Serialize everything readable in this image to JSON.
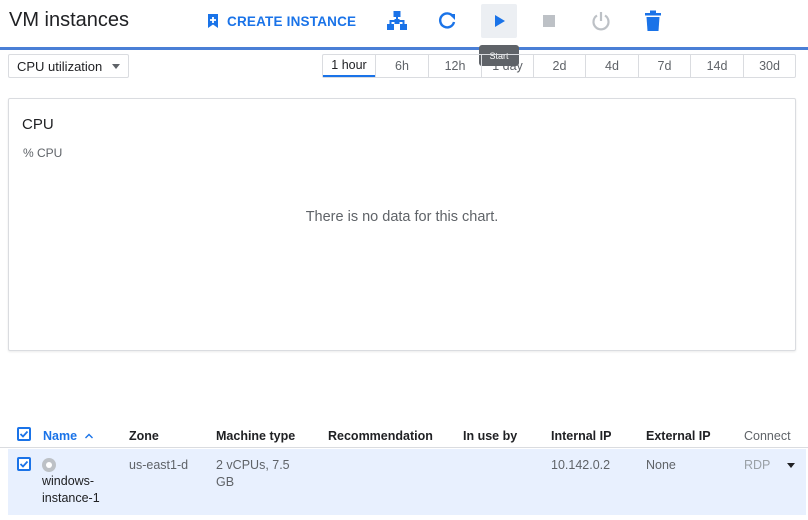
{
  "header": {
    "title": "VM instances",
    "create_label": "CREATE INSTANCE",
    "tooltip": "Start"
  },
  "toolbar_icons": [
    "import-vm-icon",
    "refresh-icon",
    "start-icon",
    "stop-icon",
    "reset-icon",
    "delete-icon"
  ],
  "metric": {
    "selected": "CPU utilization"
  },
  "time_ranges": [
    "1 hour",
    "6h",
    "12h",
    "1 day",
    "2d",
    "4d",
    "7d",
    "14d",
    "30d"
  ],
  "time_range_selected": "1 hour",
  "chart": {
    "title": "CPU",
    "unit": "% CPU",
    "empty_message": "There is no data for this chart."
  },
  "table": {
    "columns": {
      "name": "Name",
      "zone": "Zone",
      "machine_type": "Machine type",
      "recommendation": "Recommendation",
      "in_use_by": "In use by",
      "internal_ip": "Internal IP",
      "external_ip": "External IP",
      "connect": "Connect"
    },
    "rows": [
      {
        "name_line1": "windows-",
        "name_line2": "instance-1",
        "zone": "us-east1-d",
        "machine_type_line1": "2 vCPUs, 7.5",
        "machine_type_line2": "GB",
        "recommendation": "",
        "in_use_by": "",
        "internal_ip": "10.142.0.2",
        "external_ip": "None",
        "connect": "RDP"
      }
    ]
  },
  "colors": {
    "accent": "#1a73e8",
    "selected_row": "#e8f0fe",
    "divider": "#4a7fd6"
  }
}
